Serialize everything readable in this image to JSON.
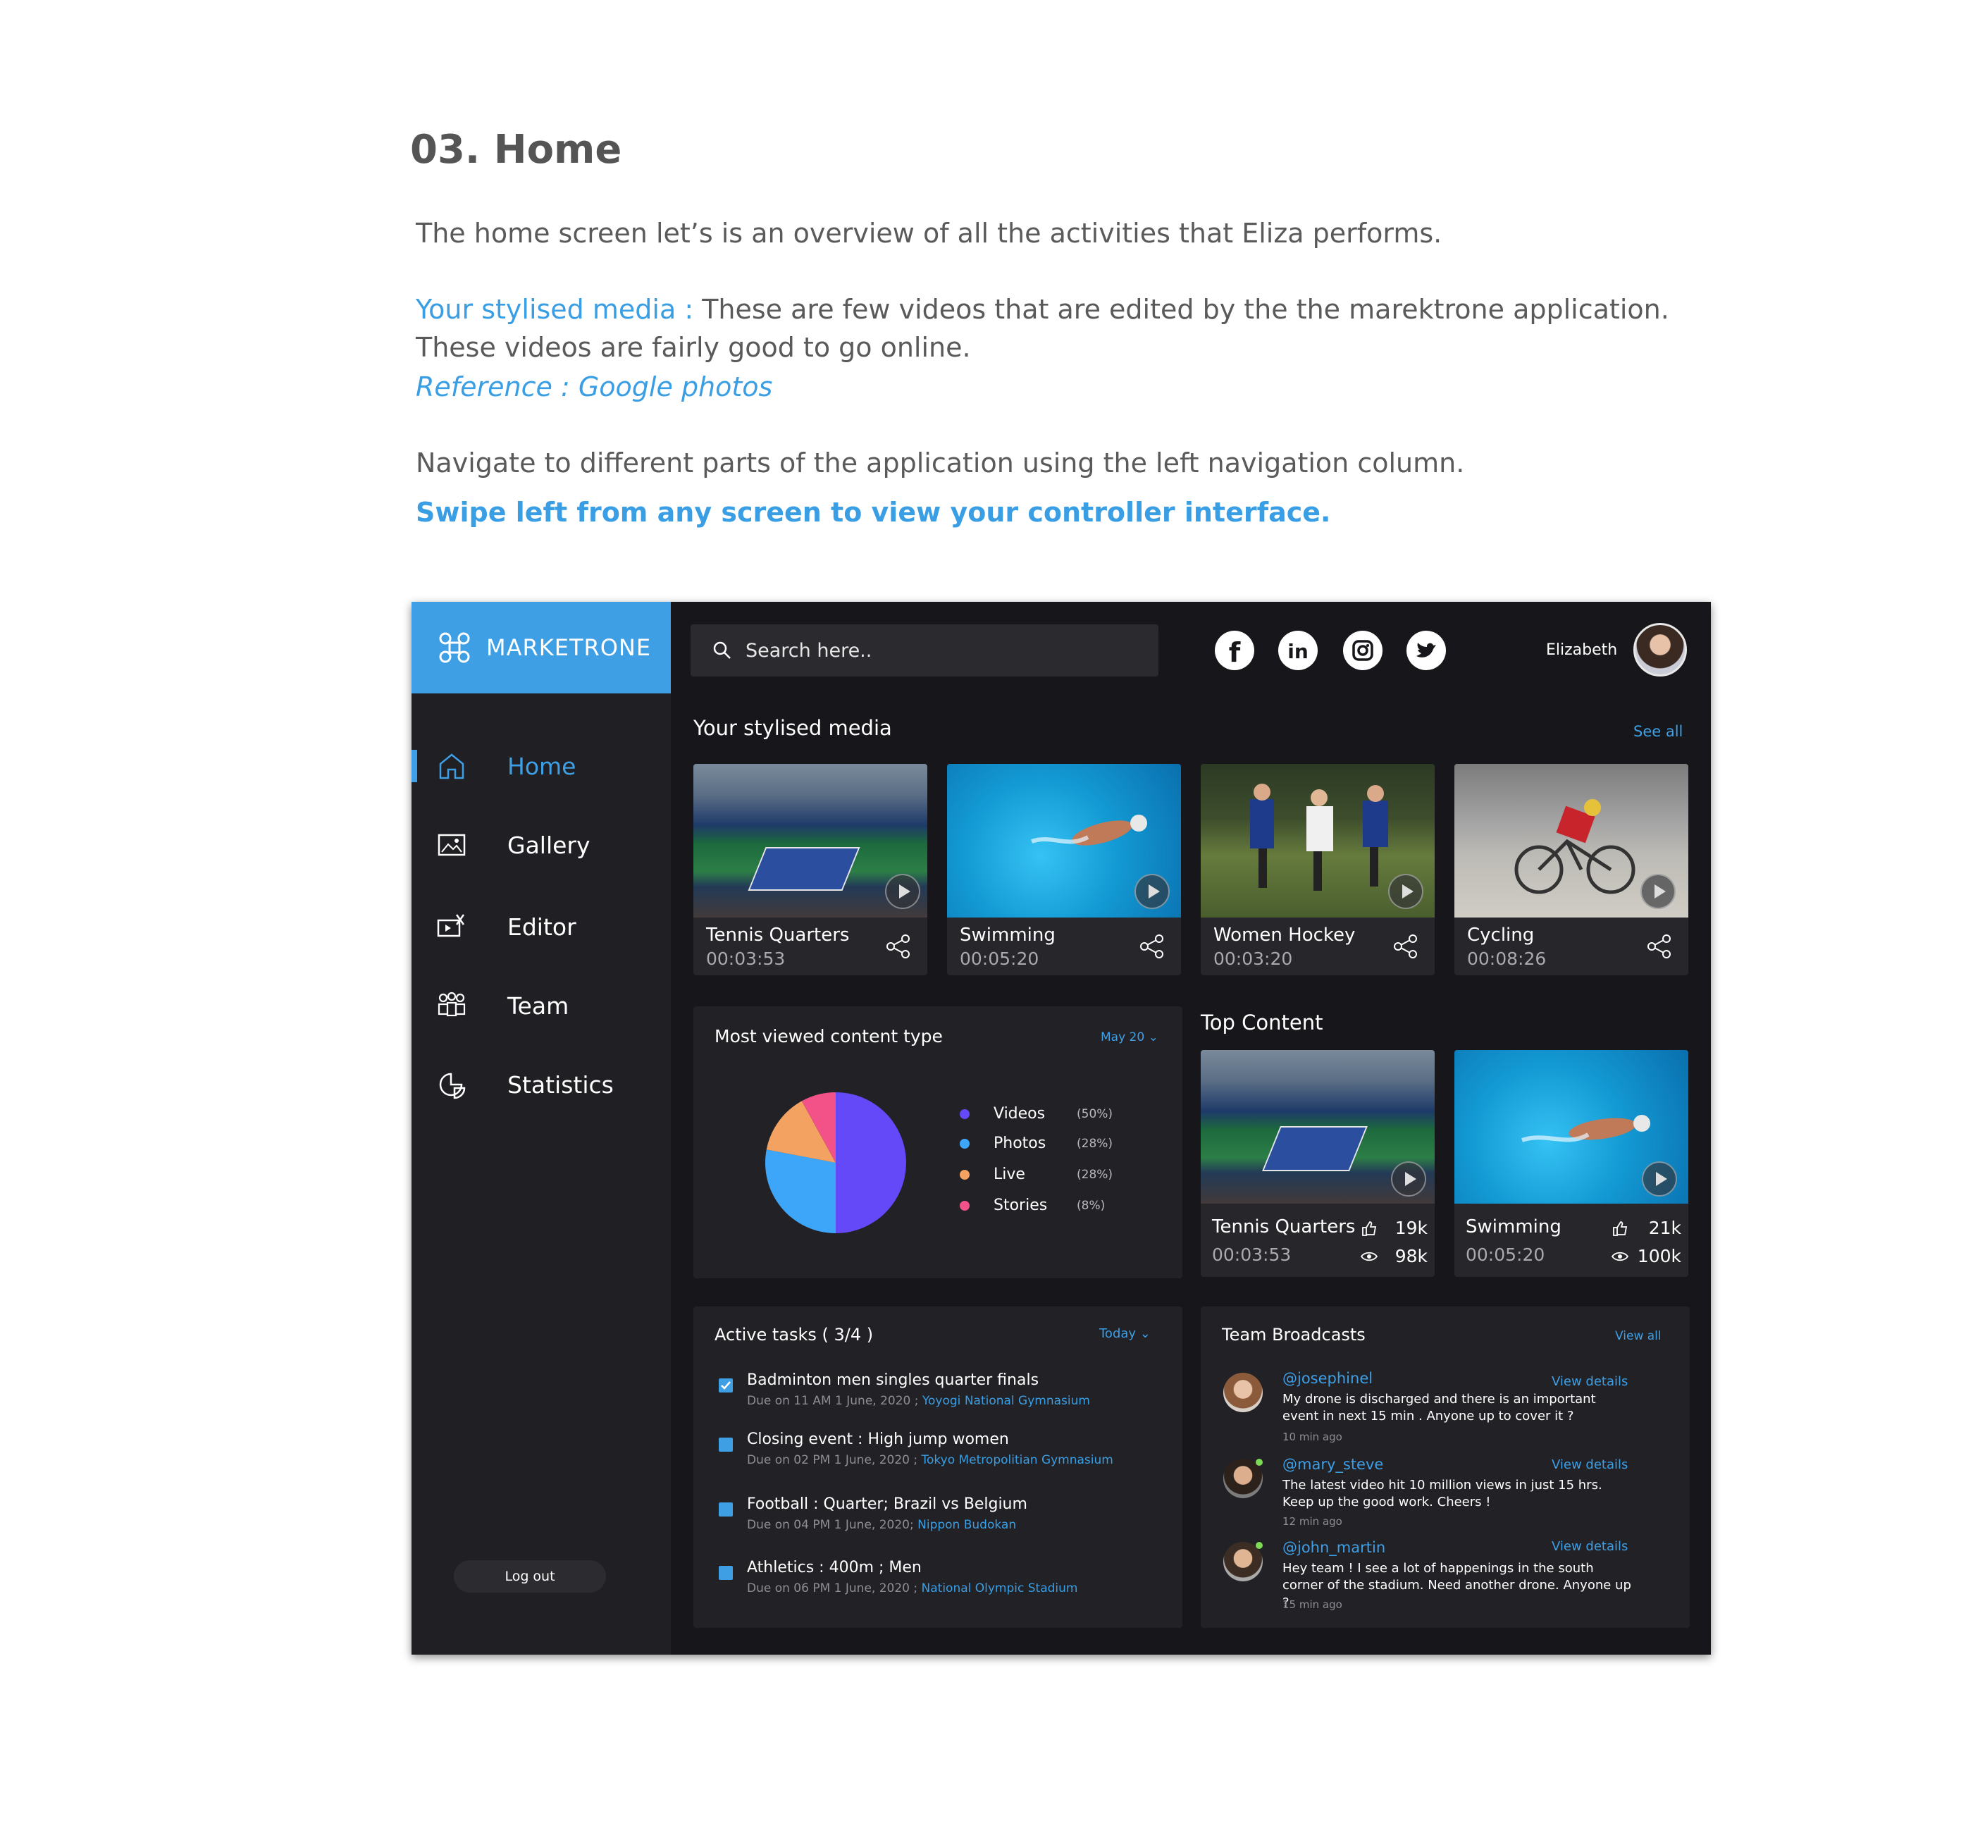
{
  "doc": {
    "title": "03. Home",
    "intro": "The home screen let’s is an overview of all the activities that Eliza performs.",
    "media_label": "Your stylised media :",
    "media_desc": " These are few videos that are edited by the the marektrone application.",
    "media_desc2": "These videos are fairly good to go online.",
    "reference": "Reference : Google photos",
    "navigate": "Navigate to different parts of the application using the left navigation column.",
    "swipe": "Swipe left from any screen to view your controller interface."
  },
  "app": {
    "brand": "MARKETRONE",
    "search_placeholder": "Search here..",
    "user_name": "Elizabeth",
    "nav": [
      {
        "label": "Home",
        "icon": "home-icon"
      },
      {
        "label": "Gallery",
        "icon": "gallery-icon"
      },
      {
        "label": "Editor",
        "icon": "editor-icon"
      },
      {
        "label": "Team",
        "icon": "team-icon"
      },
      {
        "label": "Statistics",
        "icon": "statistics-icon"
      }
    ],
    "logout": "Log out",
    "social": [
      "facebook-icon",
      "linkedin-icon",
      "instagram-icon",
      "twitter-icon"
    ],
    "accent": "#3e9fe5"
  },
  "media": {
    "title": "Your stylised media",
    "see_all": "See all",
    "items": [
      {
        "title": "Tennis Quarters",
        "time": "00:03:53"
      },
      {
        "title": "Swimming",
        "time": "00:05:20"
      },
      {
        "title": "Women Hockey",
        "time": "00:03:20"
      },
      {
        "title": "Cycling",
        "time": "00:08:26"
      }
    ]
  },
  "content_type": {
    "title": "Most viewed content type",
    "period": "May 20",
    "legend": [
      {
        "label": "Videos",
        "pct": "(50%)",
        "color": "#6349f8"
      },
      {
        "label": "Photos",
        "pct": "(28%)",
        "color": "#3ea6f8"
      },
      {
        "label": "Live",
        "pct": "(28%)",
        "color": "#f4a261"
      },
      {
        "label": "Stories",
        "pct": "(8%)",
        "color": "#f25287"
      }
    ]
  },
  "chart_data": {
    "type": "pie",
    "categories": [
      "Videos",
      "Photos",
      "Live",
      "Stories"
    ],
    "values": [
      50,
      28,
      14,
      8
    ]
  },
  "top_content": {
    "title": "Top Content",
    "items": [
      {
        "title": "Tennis Quarters",
        "time": "00:03:53",
        "likes": "19k",
        "views": "98k"
      },
      {
        "title": "Swimming",
        "time": "00:05:20",
        "likes": "21k",
        "views": "100k"
      }
    ]
  },
  "tasks": {
    "title": "Active tasks ( 3/4 )",
    "period": "Today",
    "items": [
      {
        "title": "Badminton men singles quarter finals",
        "due": "Due on 11 AM 1 June, 2020 ;",
        "venue": "Yoyogi National Gymnasium",
        "done": true
      },
      {
        "title": "Closing event : High jump women",
        "due": "Due on 02 PM 1 June, 2020 ;",
        "venue": "Tokyo Metropolitian Gymnasium",
        "done": false
      },
      {
        "title": "Football : Quarter; Brazil vs Belgium",
        "due": "Due on 04 PM 1 June, 2020;",
        "venue": "Nippon Budokan",
        "done": false
      },
      {
        "title": "Athletics : 400m ; Men",
        "due": "Due on 06 PM 1 June, 2020 ;",
        "venue": "National Olympic Stadium",
        "done": false
      }
    ]
  },
  "broadcasts": {
    "title": "Team Broadcasts",
    "view_all": "View all",
    "items": [
      {
        "user": "@josephinel",
        "view": "View details",
        "msg": "My drone is discharged and there is an important event in next 15 min . Anyone up to cover it ?",
        "time": "10 min ago"
      },
      {
        "user": "@mary_steve",
        "view": "View details",
        "msg": "The latest video hit 10 million views in just 15 hrs. Keep up the good work. Cheers !",
        "time": "12 min ago"
      },
      {
        "user": "@john_martin",
        "view": "View details",
        "msg": "Hey team ! I see a lot of happenings in the south corner of the stadium. Need another drone. Anyone up ?",
        "time": "15 min ago"
      }
    ]
  }
}
